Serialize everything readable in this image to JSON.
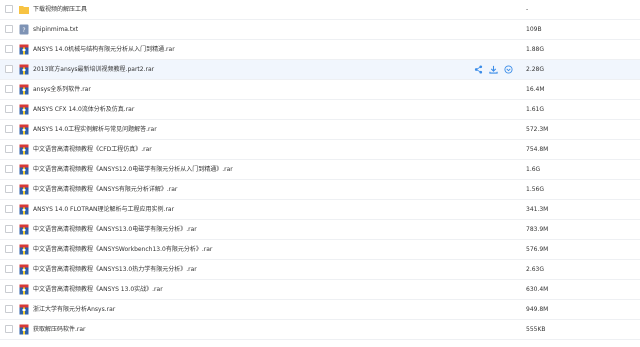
{
  "colors": {
    "folder": "#f7c343",
    "archive_body": "#2e5fa8",
    "archive_top": "#d63a3a",
    "txt": "#7e93b5",
    "action_icon": "#3b8ce8",
    "hover_row": "#f1f6fd"
  },
  "files": [
    {
      "name": "下载视频的解压工具",
      "size": "-",
      "icon": "folder-icon"
    },
    {
      "name": "shipinmima.txt",
      "size": "109B",
      "icon": "txt-file-icon"
    },
    {
      "name": "ANSYS 14.0机械与结构有限元分析从入门到精通.rar",
      "size": "1.88G",
      "icon": "rar-file-icon"
    },
    {
      "name": "2013官方ansys最新培训视频教程.part2.rar",
      "size": "2.28G",
      "icon": "rar-file-icon",
      "hovered": true
    },
    {
      "name": "ansys全系列软件.rar",
      "size": "16.4M",
      "icon": "rar-file-icon"
    },
    {
      "name": "ANSYS CFX 14.0流体分析及仿真.rar",
      "size": "1.61G",
      "icon": "rar-file-icon"
    },
    {
      "name": "ANSYS 14.0工程实例解析与常见问题解答.rar",
      "size": "572.3M",
      "icon": "rar-file-icon"
    },
    {
      "name": "中文语音高清视频教程《CFD工程仿真》.rar",
      "size": "754.8M",
      "icon": "rar-file-icon"
    },
    {
      "name": "中文语音高清视频教程《ANSYS12.0电磁学有限元分析从入门到精通》.rar",
      "size": "1.6G",
      "icon": "rar-file-icon"
    },
    {
      "name": "中文语音高清视频教程《ANSYS有限元分析详解》.rar",
      "size": "1.56G",
      "icon": "rar-file-icon"
    },
    {
      "name": "ANSYS 14.0 FLOTRAN理论解析与工程应用实例.rar",
      "size": "341.3M",
      "icon": "rar-file-icon"
    },
    {
      "name": "中文语音高清视频教程《ANSYS13.0电磁学有限元分析》.rar",
      "size": "783.9M",
      "icon": "rar-file-icon"
    },
    {
      "name": "中文语音高清视频教程《ANSYSWorkbench13.0有限元分析》.rar",
      "size": "576.9M",
      "icon": "rar-file-icon"
    },
    {
      "name": "中文语音高清视频教程《ANSYS13.0热力学有限元分析》.rar",
      "size": "2.63G",
      "icon": "rar-file-icon"
    },
    {
      "name": "中文语音高清视频教程《ANSYS 13.0实战》.rar",
      "size": "630.4M",
      "icon": "rar-file-icon"
    },
    {
      "name": "浙江大学有限元分析Ansys.rar",
      "size": "949.8M",
      "icon": "rar-file-icon"
    },
    {
      "name": "获取解压码软件.rar",
      "size": "555KB",
      "icon": "rar-file-icon"
    }
  ],
  "row_actions": [
    "share-icon",
    "download-icon",
    "more-icon"
  ]
}
